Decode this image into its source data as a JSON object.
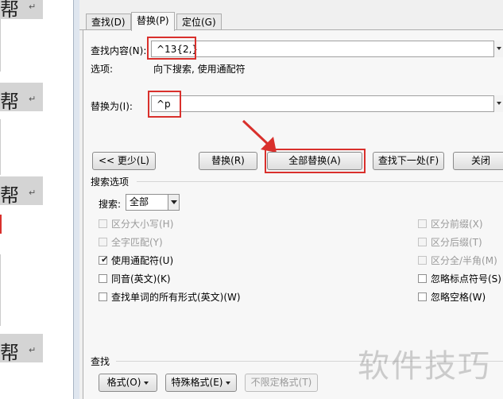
{
  "document": {
    "line_text": "帮",
    "mark": "↵"
  },
  "tabs": [
    {
      "label": "查找(D)"
    },
    {
      "label": "替换(P)"
    },
    {
      "label": "定位(G)"
    }
  ],
  "find": {
    "label": "查找内容(N):",
    "value": "^13{2,}",
    "options_label": "选项:",
    "options_value": "向下搜索, 使用通配符"
  },
  "replace": {
    "label": "替换为(I):",
    "value": "^p"
  },
  "buttons": {
    "less": "<< 更少(L)",
    "replace": "替换(R)",
    "replace_all": "全部替换(A)",
    "find_next": "查找下一处(F)",
    "close": "关闭"
  },
  "search_options": {
    "title": "搜索选项",
    "search_label": "搜索:",
    "search_value": "全部"
  },
  "checkboxes_left": [
    {
      "label": "区分大小写(H)",
      "checked": false,
      "disabled": true
    },
    {
      "label": "全字匹配(Y)",
      "checked": false,
      "disabled": true
    },
    {
      "label": "使用通配符(U)",
      "checked": true,
      "disabled": false
    },
    {
      "label": "同音(英文)(K)",
      "checked": false,
      "disabled": false
    },
    {
      "label": "查找单词的所有形式(英文)(W)",
      "checked": false,
      "disabled": false
    }
  ],
  "checkboxes_right": [
    {
      "label": "区分前缀(X)",
      "checked": false,
      "disabled": true
    },
    {
      "label": "区分后缀(T)",
      "checked": false,
      "disabled": true
    },
    {
      "label": "区分全/半角(M)",
      "checked": false,
      "disabled": true
    },
    {
      "label": "忽略标点符号(S)",
      "checked": false,
      "disabled": false
    },
    {
      "label": "忽略空格(W)",
      "checked": false,
      "disabled": false
    }
  ],
  "find_section": {
    "title": "查找",
    "format": "格式(O)",
    "special": "特殊格式(E)",
    "no_format": "不限定格式(T)"
  },
  "watermark": "软件技巧",
  "colors": {
    "highlight_red": "#d9302c",
    "dialog_bg": "#f0f0f0"
  }
}
